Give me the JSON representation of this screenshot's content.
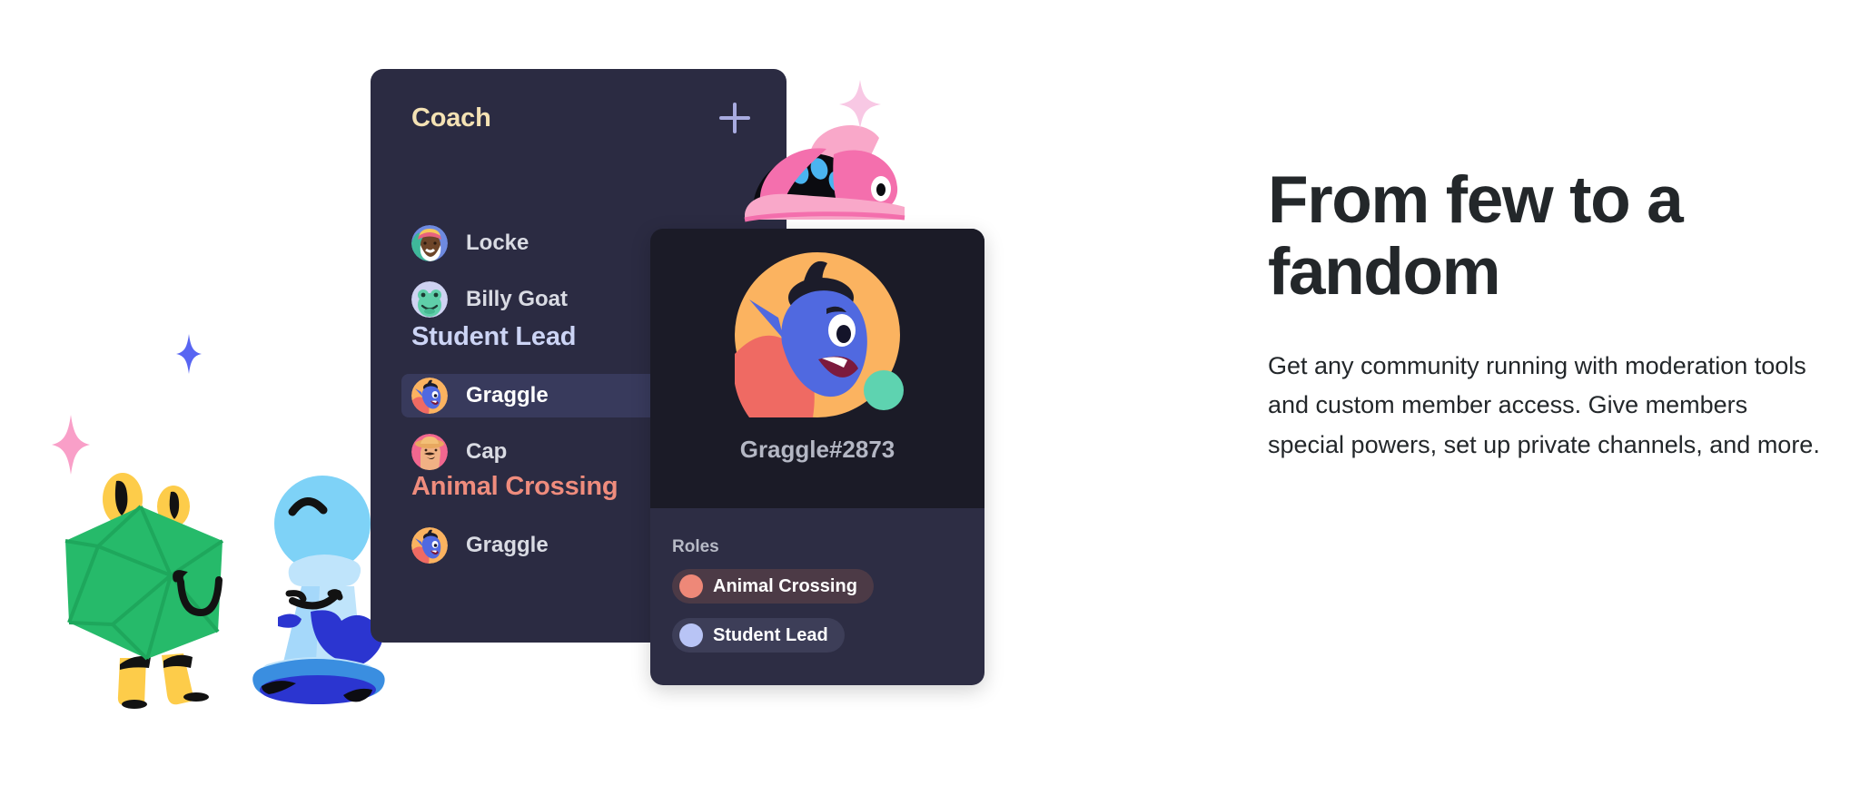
{
  "member_list": {
    "add_icon": "plus-icon",
    "groups": [
      {
        "name": "Coach",
        "color": "#f4e2b4",
        "members": [
          {
            "name": "Locke",
            "avatar": "santa-avatar",
            "selected": false
          },
          {
            "name": "Billy Goat",
            "avatar": "frog-avatar",
            "selected": false
          }
        ]
      },
      {
        "name": "Student Lead",
        "color": "#ccd4f5",
        "members": [
          {
            "name": "Graggle",
            "avatar": "genie-avatar",
            "selected": true
          },
          {
            "name": "Cap",
            "avatar": "cowboy-avatar",
            "selected": false
          }
        ]
      },
      {
        "name": "Animal Crossing",
        "color": "#ef8c7d",
        "members": [
          {
            "name": "Graggle",
            "avatar": "genie-avatar",
            "selected": false
          }
        ]
      }
    ]
  },
  "profile_card": {
    "avatar": "genie-avatar-large",
    "status": "online",
    "status_color": "#5ed3b0",
    "username_tag": "Graggle#2873",
    "roles_label": "Roles",
    "roles": [
      {
        "label": "Animal Crossing",
        "dot_color": "#ee8878",
        "pill_color": "#4c3a46"
      },
      {
        "label": "Student Lead",
        "dot_color": "#b8c4f5",
        "pill_color": "#3d3e58"
      }
    ]
  },
  "copy": {
    "heading": "From few to a fandom",
    "body": "Get any community running with moderation tools and custom member access. Give members special powers, set up private channels, and more."
  },
  "decor": {
    "dice_character": "green-d20-character",
    "pawn_character": "blue-chess-pawn-character",
    "worm_character": "pink-worm-character",
    "sparkles": [
      "pink-sparkle",
      "blue-sparkle",
      "pink-sparkle-top"
    ]
  },
  "colors": {
    "panel_bg": "#2b2b42",
    "card_body_bg": "#2d2d44",
    "card_header_bg": "#1b1b27",
    "selected_row": "#383a5c",
    "page_bg": "#ffffff",
    "text_dark": "#23272a"
  }
}
